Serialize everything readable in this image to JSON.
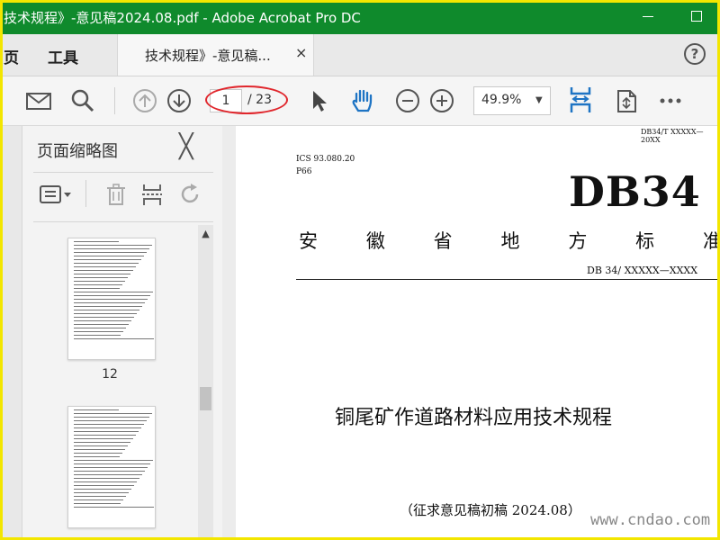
{
  "window": {
    "title": "技术规程》-意见稿2024.08.pdf - Adobe Acrobat Pro DC"
  },
  "menubar": {
    "items": [
      "页",
      "工具"
    ],
    "tab_label": "技术规程》-意见稿...",
    "tab_close": "×",
    "help": "?"
  },
  "toolbar": {
    "page_current": "1",
    "page_total": "/ 23",
    "zoom": "49.9%",
    "icons": [
      "email-icon",
      "search-icon",
      "page-up-icon",
      "page-down-icon",
      "select-cursor-icon",
      "hand-tool-icon",
      "zoom-out-icon",
      "zoom-in-icon",
      "fit-width-icon",
      "rotate-page-icon",
      "more-icon"
    ]
  },
  "panel": {
    "title": "页面缩略图",
    "close": "╳",
    "thumbnails": [
      {
        "label": "12"
      },
      {
        "label": ""
      }
    ]
  },
  "document": {
    "std_code_top": "DB34/T XXXXX—20XX",
    "ics": "ICS 93.080.20",
    "ccs": "P66",
    "db": "DB34",
    "province_chars": [
      "安",
      "徽",
      "省",
      "地",
      "方",
      "标",
      "准"
    ],
    "std_number": "DB 34/ XXXXX—XXXX",
    "title": "铜尾矿作道路材料应用技术规程",
    "draft_note": "（征求意见稿初稿 2024.08）"
  },
  "watermark": "www.cndao.com",
  "colors": {
    "titlebar": "#0f8a2c",
    "frame": "#f3e600",
    "highlight": "#e0262c",
    "accent_blue": "#1e74c4"
  }
}
